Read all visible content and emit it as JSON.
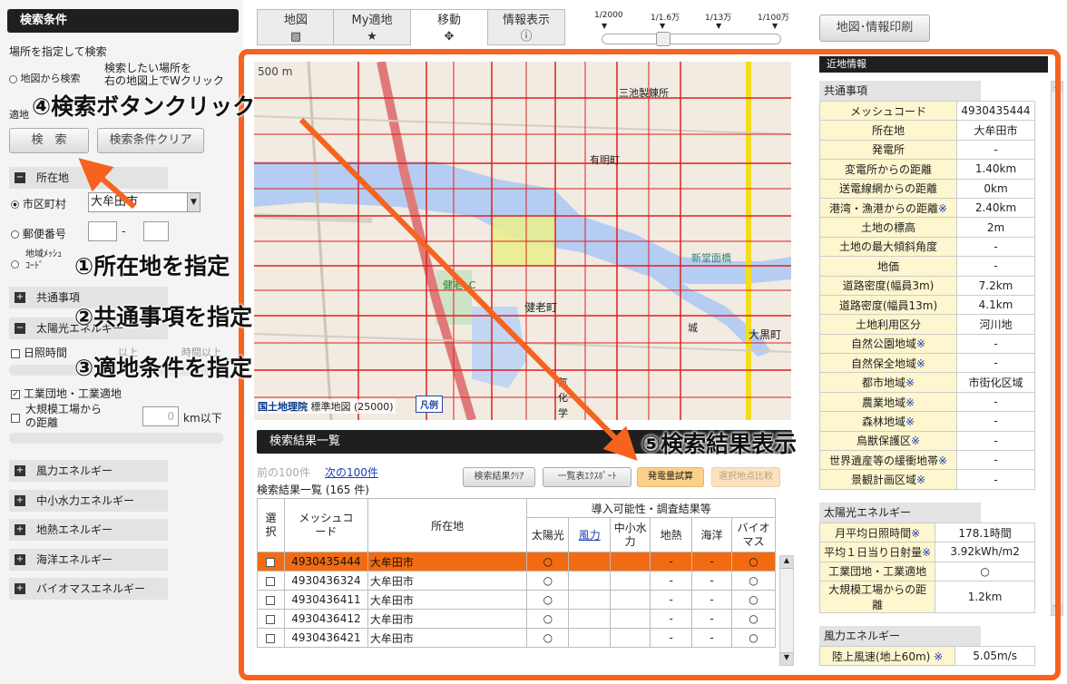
{
  "left": {
    "title": "検索条件",
    "section_label": "場所を指定して検索",
    "map_search_option": "地図から検索",
    "map_search_desc1": "検索したい場所を",
    "map_search_desc2": "右の地図上でWクリック",
    "fit_label_partial": "適地",
    "search_button": "検　索",
    "clear_button": "検索条件クリア",
    "location_section": "所在地",
    "city_option": "市区町村",
    "city_value": "大牟田市",
    "postal_option": "郵便番号",
    "postal_dash": "-",
    "mesh_option1": "地域ﾒｯｼｭ",
    "mesh_option2": "ｺｰﾄﾞ",
    "common_section": "共通事項",
    "solar_section": "太陽光エネルギー",
    "sunshine_label": "日照時間",
    "sunshine_partial1": "以上",
    "sunshine_partial2": "時間以上",
    "industrial_label": "工業団地・工業適地",
    "factory_label1": "大規模工場から",
    "factory_label2": "の距離",
    "factory_value": "0",
    "factory_unit": "km以下",
    "sections": [
      "風力エネルギー",
      "中小水力エネルギー",
      "地熱エネルギー",
      "海洋エネルギー",
      "バイオマスエネルギー"
    ]
  },
  "tabs": [
    {
      "label": "地図",
      "icon": "layers-icon",
      "glyph": "▧"
    },
    {
      "label": "My適地",
      "icon": "star-icon",
      "glyph": "★"
    },
    {
      "label": "移動",
      "icon": "move-icon",
      "glyph": "✥"
    },
    {
      "label": "情報表示",
      "icon": "info-icon",
      "glyph": "ⓘ"
    }
  ],
  "scale": {
    "labels": [
      "1/2000",
      "1/1.6万",
      "1/13万",
      "1/100万"
    ]
  },
  "print_button": "地図･情報印刷",
  "map": {
    "scale_label": "500 m",
    "places": [
      "三池製錬所",
      "有明町",
      "新堂面橋",
      "健老町",
      "大黒町",
      "城",
      "気",
      "化",
      "学",
      "健老I C"
    ],
    "credit": "国土地理院",
    "credit2": "標準地図 (25000)",
    "legend_button": "凡例"
  },
  "annotations": {
    "a4": "④検索ボタンクリック",
    "a1": "①所在地を指定",
    "a2": "②共通事項を指定",
    "a3": "③適地条件を指定",
    "a5": "⑤検索結果表示"
  },
  "results": {
    "title": "検索結果一覧",
    "prev": "前の100件",
    "next": "次の100件",
    "clear_btn": "検索結果ｸﾘｱ",
    "export_btn": "一覧表ｴｸｽﾎﾟｰﾄ",
    "trial_btn": "発電量試算",
    "compare_btn": "選択地点比較",
    "count": "検索結果一覧 (165 件)",
    "h_select": "選択",
    "h_mesh": "メッシュコード",
    "h_loc": "所在地",
    "h_group": "導入可能性・調査結果等",
    "h_cols": [
      "太陽光",
      "風力",
      "中小水力",
      "地熱",
      "海洋",
      "バイオマス"
    ],
    "rows": [
      {
        "mesh": "4930435444",
        "loc": "大牟田市",
        "v": [
          "○",
          "",
          "",
          "-",
          "-",
          "○"
        ]
      },
      {
        "mesh": "4930436324",
        "loc": "大牟田市",
        "v": [
          "○",
          "",
          "",
          "-",
          "-",
          "○"
        ]
      },
      {
        "mesh": "4930436411",
        "loc": "大牟田市",
        "v": [
          "○",
          "",
          "",
          "-",
          "-",
          "○"
        ]
      },
      {
        "mesh": "4930436412",
        "loc": "大牟田市",
        "v": [
          "○",
          "",
          "",
          "-",
          "-",
          "○"
        ]
      },
      {
        "mesh": "4930436421",
        "loc": "大牟田市",
        "v": [
          "○",
          "",
          "",
          "-",
          "-",
          "○"
        ]
      }
    ]
  },
  "info": {
    "title_partial": "近地情報",
    "common_title": "共通事項",
    "common_rows": [
      [
        "メッシュコード",
        "4930435444"
      ],
      [
        "所在地",
        "大牟田市"
      ],
      [
        "発電所",
        "-"
      ],
      [
        "変電所からの距離",
        "1.40km"
      ],
      [
        "送電線網からの距離",
        "0km"
      ],
      [
        "港湾・漁港からの距離※",
        "2.40km"
      ],
      [
        "土地の標高",
        "2m"
      ],
      [
        "土地の最大傾斜角度",
        "-"
      ],
      [
        "地価",
        "-"
      ],
      [
        "道路密度(幅員3m)",
        "7.2km"
      ],
      [
        "道路密度(幅員13m)",
        "4.1km"
      ],
      [
        "土地利用区分",
        "河川地"
      ],
      [
        "自然公園地域※",
        "-"
      ],
      [
        "自然保全地域※",
        "-"
      ],
      [
        "都市地域※",
        "市街化区域"
      ],
      [
        "農業地域※",
        "-"
      ],
      [
        "森林地域※",
        "-"
      ],
      [
        "鳥獣保護区※",
        "-"
      ],
      [
        "世界遺産等の緩衝地帯※",
        "-"
      ],
      [
        "景観計画区域※",
        "-"
      ]
    ],
    "solar_title": "太陽光エネルギー",
    "solar_rows": [
      [
        "月平均日照時間※",
        "178.1時間"
      ],
      [
        "平均１日当り日射量※",
        "3.92kWh/m2"
      ],
      [
        "工業団地・工業適地",
        "○"
      ],
      [
        "大規模工場からの距離",
        "1.2km"
      ]
    ],
    "wind_title": "風力エネルギー",
    "wind_rows": [
      [
        "陸上風速(地上60m) ※",
        "5.05m/s"
      ]
    ]
  },
  "colors": {
    "accent": "#f5631f",
    "selected_row": "#f26b12",
    "dark": "#1f1f1f",
    "info_key": "#fdf6cf"
  }
}
